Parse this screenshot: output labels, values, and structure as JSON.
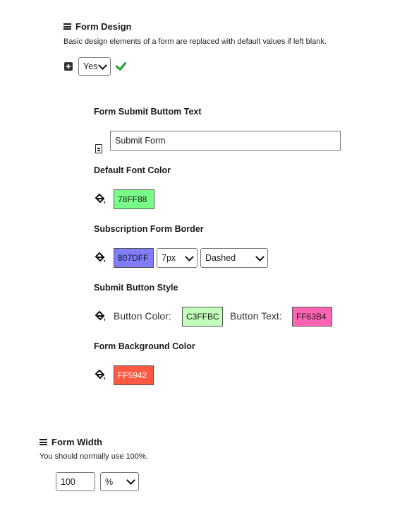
{
  "form_design": {
    "title": "Form Design",
    "description": "Basic design elements of a form are replaced with default values if left blank.",
    "enabled_value": "Yes"
  },
  "submit_text": {
    "label": "Form Submit Buttom Text",
    "value": "Submit Form"
  },
  "font_color": {
    "label": "Default Font Color",
    "value": "78FF88",
    "color": "#78FF88"
  },
  "border": {
    "label": "Subscription Form Border",
    "color_value": "807DFF",
    "color": "#807DFF",
    "width_value": "7px",
    "style_value": "Dashed"
  },
  "button_style": {
    "label": "Submit Button Style",
    "button_color_label": "Button Color:",
    "button_color_value": "C3FFBC",
    "button_color": "#C3FFBC",
    "button_text_label": "Button Text:",
    "button_text_value": "FF63B4",
    "button_text_color": "#FF63B4"
  },
  "background": {
    "label": "Form Background Color",
    "value": "FF5942",
    "color": "#FF5942"
  },
  "form_width": {
    "title": "Form Width",
    "description": "You should normally use 100%.",
    "value": "100",
    "unit_value": "%"
  },
  "icons": {
    "heading": "hamburger-icon",
    "expand": "plus-square-icon",
    "confirm": "check-icon",
    "text_field": "document-icon",
    "color_picker": "paint-bucket-icon"
  }
}
